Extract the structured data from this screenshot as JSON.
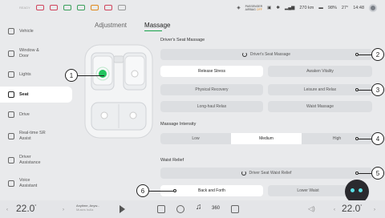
{
  "status": {
    "ready": "READY",
    "passenger_airbag_line1": "PASSENGER",
    "passenger_airbag_line2": "AIRBAG",
    "passenger_airbag_state": "OFF",
    "range": "270 km",
    "battery": "98%",
    "outside_temp": "27°",
    "time": "14:48"
  },
  "sidebar": {
    "items": [
      {
        "label": "Vehicle",
        "icon": "car-icon"
      },
      {
        "label": "Window & Door",
        "icon": "window-icon"
      },
      {
        "label": "Lights",
        "icon": "light-icon"
      },
      {
        "label": "Seat",
        "icon": "seat-icon"
      },
      {
        "label": "Drive",
        "icon": "steering-icon"
      },
      {
        "label": "Real-time SR Assist",
        "icon": "sr-assist-icon"
      },
      {
        "label": "Driver Assistance",
        "icon": "driver-assist-icon"
      },
      {
        "label": "Voice Assistant",
        "icon": "voice-icon"
      }
    ],
    "active": "Seat"
  },
  "tabs": [
    "Adjustment",
    "Massage"
  ],
  "active_tab": "Massage",
  "massage": {
    "drivers_seat_massage_title": "Driver's Seat Massage",
    "drivers_seat_massage_button": "Driver's Seat Massage",
    "modes": [
      "Release Stress",
      "Awaken Vitality",
      "Physical Recovery",
      "Leisure and Relax",
      "Long-haul Relax",
      "Waist Massage"
    ],
    "selected_mode": "Release Stress",
    "intensity_title": "Massage Intensity",
    "intensity_options": [
      "Low",
      "Medium",
      "High"
    ],
    "selected_intensity": "Medium",
    "waist_relief_title": "Waist Relief",
    "waist_relief_button": "Driver Seat Waist Relief",
    "waist_options": [
      "Back and Forth",
      "Lower Waist"
    ],
    "selected_waist": "Back and Forth"
  },
  "callouts": [
    "1",
    "2",
    "3",
    "4",
    "5",
    "6"
  ],
  "bottom": {
    "left_temp": "22.0",
    "right_temp": "22.0",
    "temp_unit": "°",
    "media_title": "Anytime, Anyw...",
    "media_subtitle": "Muses hulla",
    "icons": [
      "home-icon",
      "car-icon",
      "music-icon",
      "360-view-icon",
      "apps-icon",
      "volume-icon"
    ]
  },
  "colors": {
    "accent": "#16a34a",
    "highlight": "#22c55e"
  }
}
